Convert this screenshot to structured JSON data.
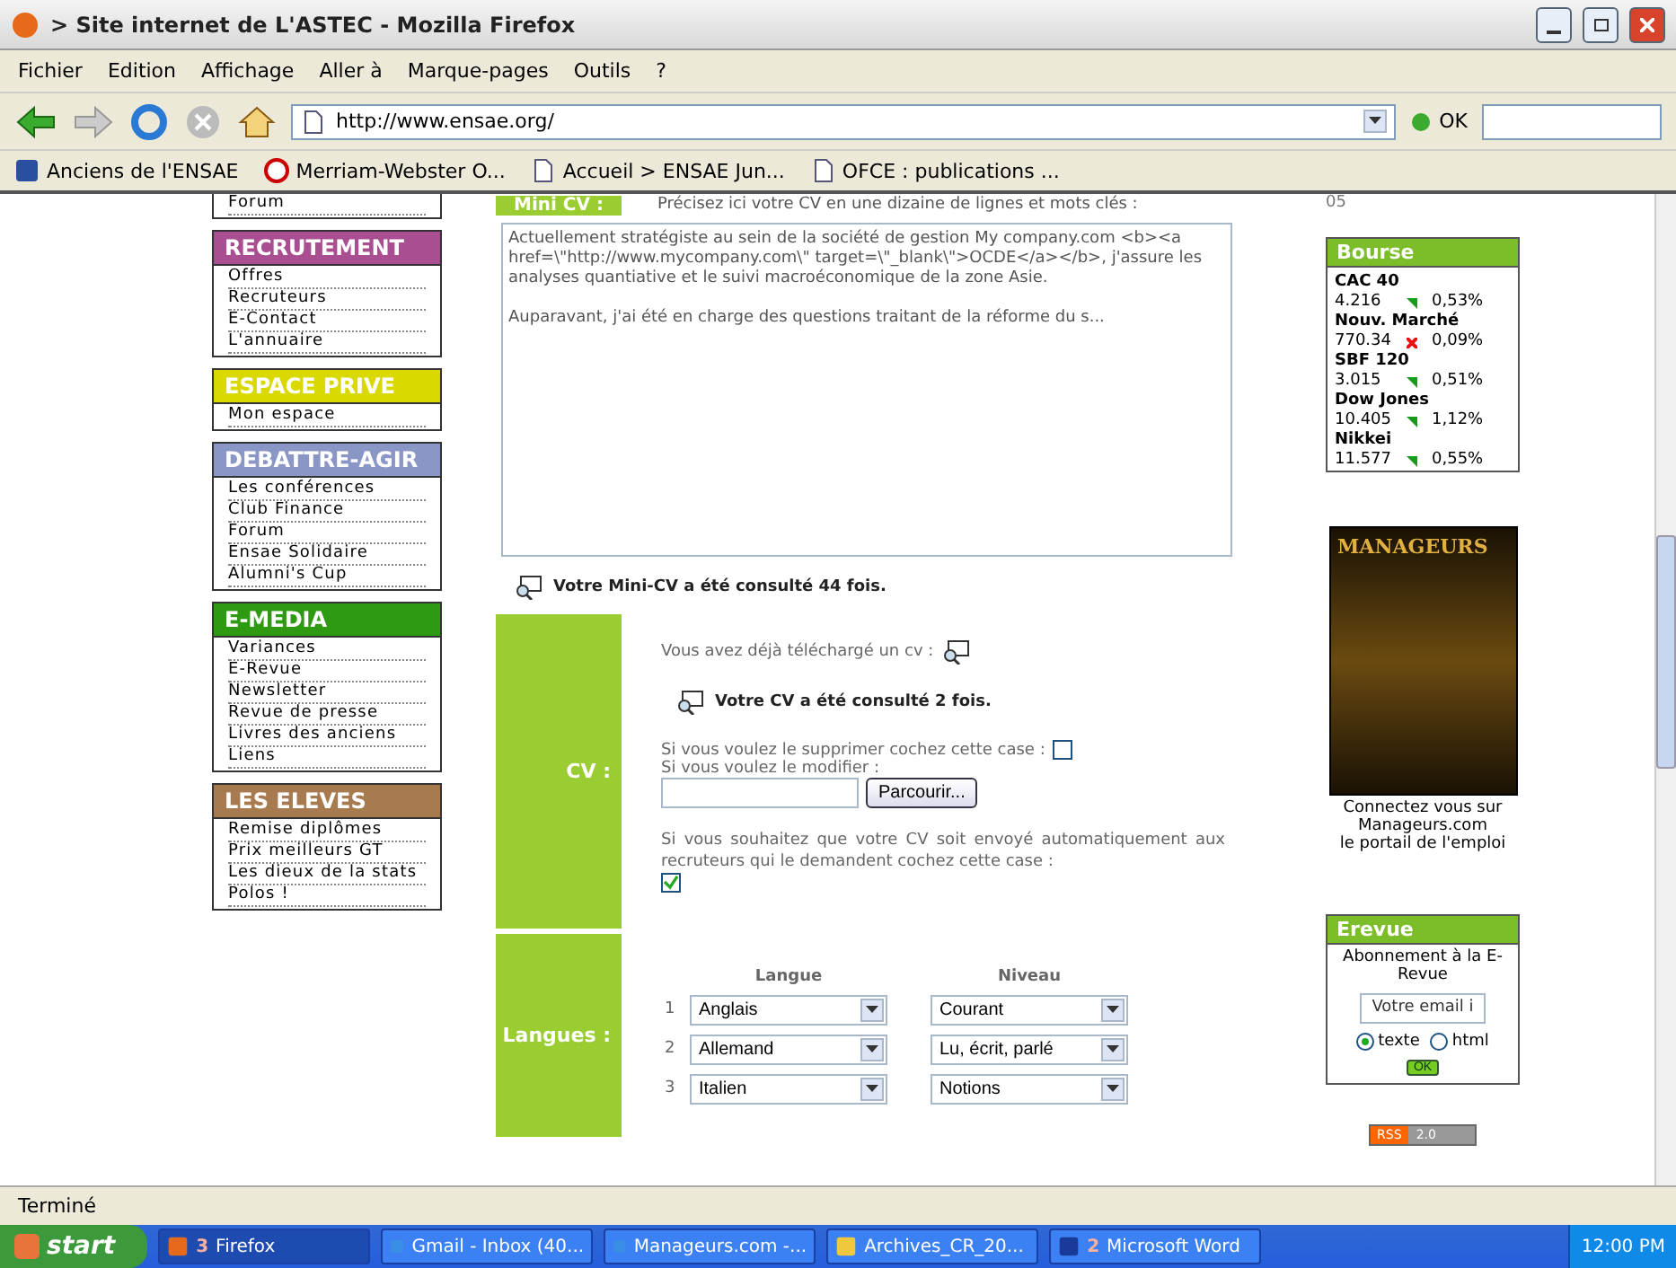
{
  "window": {
    "title": "> Site internet de L'ASTEC - Mozilla Firefox"
  },
  "menu": [
    "Fichier",
    "Edition",
    "Affichage",
    "Aller à",
    "Marque-pages",
    "Outils",
    "?"
  ],
  "toolbar": {
    "url": "http://www.ensae.org/",
    "go": "OK"
  },
  "bookmarks": [
    {
      "kind": "site",
      "label": "Anciens de l'ENSAE"
    },
    {
      "kind": "dictionary",
      "label": "Merriam-Webster O..."
    },
    {
      "kind": "page",
      "label": "Accueil > ENSAE Jun..."
    },
    {
      "kind": "page",
      "label": "OFCE : publications ..."
    }
  ],
  "sidebar": {
    "cut_item": "Forum",
    "sections": [
      {
        "title": "RECRUTEMENT",
        "color": "#a94e91",
        "items": [
          "Offres",
          "Recruteurs",
          "E-Contact",
          "L'annuaire"
        ]
      },
      {
        "title": "ESPACE PRIVE",
        "color": "#d9d900",
        "items": [
          "Mon espace"
        ]
      },
      {
        "title": "DEBATTRE-AGIR",
        "color": "#8a96c6",
        "items": [
          "Les conférences",
          "Club Finance",
          "Forum",
          "Ensae Solidaire",
          "Alumni's Cup"
        ]
      },
      {
        "title": "E-MEDIA",
        "color": "#2e9a12",
        "items": [
          "Variances",
          "E-Revue",
          "Newsletter",
          "Revue de presse",
          "Livres des anciens",
          "Liens"
        ]
      },
      {
        "title": "LES ELEVES",
        "color": "#a77a4f",
        "items": [
          "Remise diplômes",
          "Prix meilleurs GT",
          "Les dieux de la stats",
          "Polos !"
        ]
      }
    ]
  },
  "mini_cv": {
    "label": "Mini CV :",
    "hint": "Précisez ici votre CV en une dizaine de lignes et mots clés :",
    "paragraphs": [
      "Actuellement stratégiste au sein de la société de gestion My company.com <b><a href=\\\"http://www.mycompany.com\\\" target=\\\"_blank\\\">OCDE</a></b>, j'assure les analyses quantiative  et le suivi macroéconomique de la zone Asie.",
      "Auparavant, j'ai été en charge des questions traitant de la réforme du s..."
    ],
    "views": "Votre Mini-CV a été consulté 44 fois."
  },
  "cv": {
    "label": "CV :",
    "uploaded": "Vous avez déjà téléchargé un cv :",
    "views": "Votre CV a été consulté 2 fois.",
    "delete_text": "Si vous voulez le supprimer cochez cette case :",
    "delete_checked": false,
    "modify_text": "Si vous voulez le modifier :",
    "browse": "Parcourir...",
    "auto_text": "Si vous souhaitez que votre CV soit envoyé automatiquement aux recruteurs qui le demandent cochez cette case :",
    "auto_checked": true
  },
  "languages": {
    "label": "Langues :",
    "headers": [
      "Langue",
      "Niveau"
    ],
    "rows": [
      {
        "number": "1",
        "language": "Anglais",
        "level": "Courant"
      },
      {
        "number": "2",
        "language": "Allemand",
        "level": "Lu, écrit, parlé"
      },
      {
        "number": "3",
        "language": "Italien",
        "level": "Notions"
      }
    ]
  },
  "right": {
    "cut_text": "05",
    "bourse": {
      "title": "Bourse",
      "quotes": [
        {
          "name": "CAC 40",
          "value": "4.216",
          "rising": true,
          "change": "0,53%"
        },
        {
          "name": "Nouv. Marché",
          "value": "770.34",
          "rising": false,
          "change": "0,09%"
        },
        {
          "name": "SBF 120",
          "value": "3.015",
          "rising": true,
          "change": "0,51%"
        },
        {
          "name": "Dow Jones",
          "value": "10.405",
          "rising": true,
          "change": "1,12%"
        },
        {
          "name": "Nikkei",
          "value": "11.577",
          "rising": true,
          "change": "0,55%"
        }
      ]
    },
    "ad": {
      "brand": "MANAGEURS",
      "caption": [
        "Connectez vous sur",
        "Manageurs.com",
        "le portail de l'emploi"
      ]
    },
    "erevue": {
      "title": "Erevue",
      "text": "Abonnement à la E-Revue",
      "value": "Votre email i",
      "options": [
        {
          "label": "texte",
          "selected": true
        },
        {
          "label": "html",
          "selected": false
        }
      ],
      "button": "OK"
    },
    "rss": [
      "RSS",
      "2.0"
    ]
  },
  "status": "Terminé",
  "taskbar": {
    "start": "start",
    "tasks": [
      {
        "kind": "firefox",
        "count": "3",
        "label": "Firefox",
        "selected": true
      },
      {
        "kind": "browser",
        "label": "Gmail - Inbox (40...",
        "selected": false
      },
      {
        "kind": "browser",
        "label": "Manageurs.com -...",
        "selected": false
      },
      {
        "kind": "folder",
        "label": "Archives_CR_20...",
        "selected": false
      },
      {
        "kind": "word",
        "count": "2",
        "label": "Microsoft Word",
        "selected": false
      }
    ],
    "time": "12:00 PM"
  }
}
